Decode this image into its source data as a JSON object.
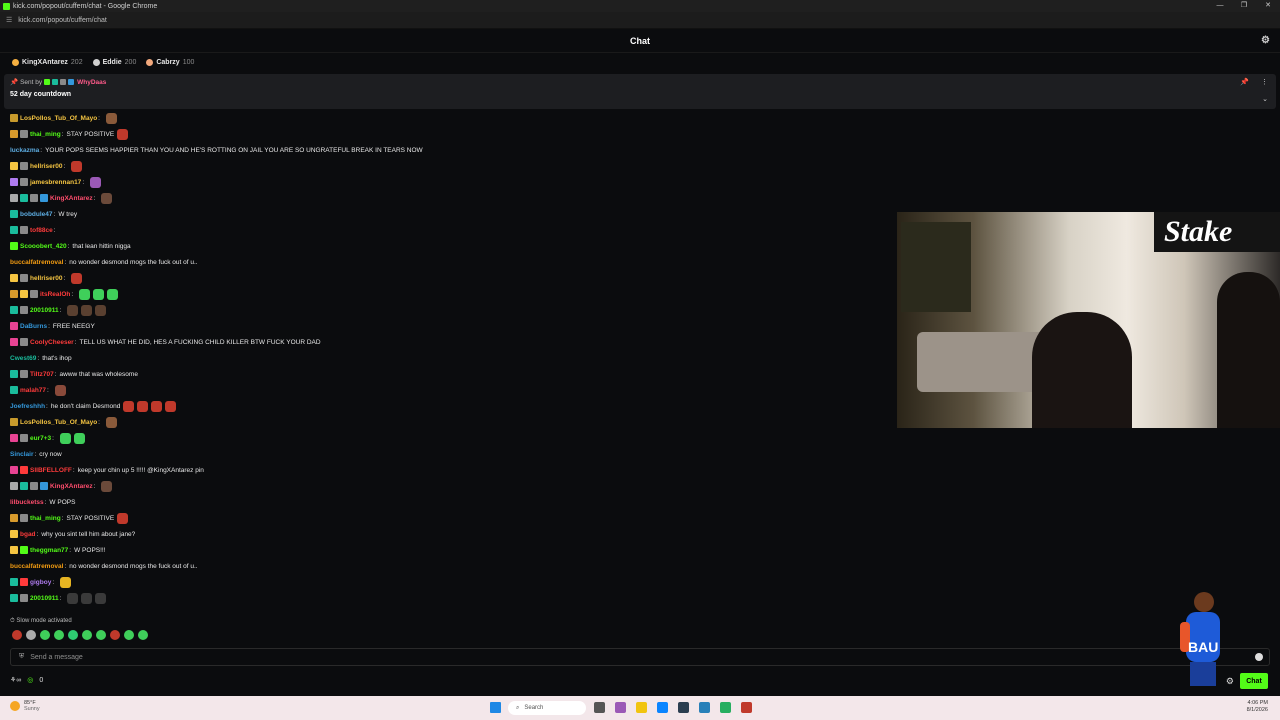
{
  "window": {
    "title": "kick.com/popout/cuffem/chat - Google Chrome",
    "url": "kick.com/popout/cuffem/chat"
  },
  "header": {
    "title": "Chat"
  },
  "leaderboard": [
    {
      "name": "KingXAntarez",
      "score": "202",
      "color": "#f5b041"
    },
    {
      "name": "Eddie",
      "score": "200",
      "color": "#d0d0d0"
    },
    {
      "name": "Cabrzy",
      "score": "100",
      "color": "#f2a97d"
    }
  ],
  "pinned": {
    "sent_by_label": "Sent by",
    "sender": "WhyDaas",
    "message": "52 day countdown"
  },
  "messages": [
    {
      "user": "LosPollos_Tub_Of_Mayo",
      "color": "#f5c542",
      "badges": [
        "#c79a2c"
      ],
      "text": "",
      "emotes": [
        "#8a5a3a"
      ]
    },
    {
      "user": "thai_ming",
      "color": "#53fc18",
      "badges": [
        "#d79a2c",
        "#8a8a8a"
      ],
      "text": "STAY POSITIVE",
      "emotes": [
        "#c0392b"
      ]
    },
    {
      "user": "luckazma",
      "color": "#5dade2",
      "badges": [],
      "text": "YOUR POPS SEEMS HAPPIER THAN YOU AND HE'S ROTTING ON JAIL  YOU ARE SO UNGRATEFUL  BREAK IN TEARS NOW",
      "emotes": []
    },
    {
      "user": "hellriser00",
      "color": "#f5c542",
      "badges": [
        "#f5c542",
        "#8a8a8a"
      ],
      "text": "",
      "emotes": [
        "#c0392b"
      ]
    },
    {
      "user": "jamesbrennan17",
      "color": "#f5c542",
      "badges": [
        "#b07cf0",
        "#8a8a8a"
      ],
      "text": "",
      "emotes": [
        "#9b59b6"
      ]
    },
    {
      "user": "KingXAntarez",
      "color": "#ff4d6d",
      "badges": [
        "#aaa",
        "#1abc9c",
        "#8a8a8a",
        "#3498db"
      ],
      "text": "",
      "emotes": [
        "#6b4a3a"
      ]
    },
    {
      "user": "bobdule47",
      "color": "#5dade2",
      "badges": [
        "#1abc9c"
      ],
      "text": "W trey",
      "emotes": []
    },
    {
      "user": "tof88ce",
      "color": "#ff3b3b",
      "badges": [
        "#1abc9c",
        "#8a8a8a"
      ],
      "text": "",
      "emotes": []
    },
    {
      "user": "Scooobert_420",
      "color": "#53fc18",
      "badges": [
        "#53fc18"
      ],
      "text": "that lean hittin nigga",
      "emotes": []
    },
    {
      "user": "buccalfatremoval",
      "color": "#f39c12",
      "badges": [],
      "text": "no wonder desmond mogs the fuck out of u..",
      "emotes": []
    },
    {
      "user": "hellriser00",
      "color": "#f5c542",
      "badges": [
        "#f5c542",
        "#8a8a8a"
      ],
      "text": "",
      "emotes": [
        "#c0392b"
      ]
    },
    {
      "user": "itsRealOh",
      "color": "#ff3b3b",
      "badges": [
        "#d79a2c",
        "#f5c542",
        "#8a8a8a"
      ],
      "text": "",
      "emotes": [
        "#3fcf5a",
        "#3fcf5a",
        "#3fcf5a"
      ]
    },
    {
      "user": "20010911",
      "color": "#53fc18",
      "badges": [
        "#1abc9c",
        "#8a8a8a"
      ],
      "text": "",
      "emotes": [
        "#5a4030",
        "#5a4030",
        "#5a4030"
      ]
    },
    {
      "user": "DaBurns",
      "color": "#3498db",
      "badges": [
        "#e84393"
      ],
      "text": "FREE NEEGY",
      "emotes": []
    },
    {
      "user": "CoolyCheeser",
      "color": "#ff3b3b",
      "badges": [
        "#e84393",
        "#8a8a8a"
      ],
      "text": "TELL US WHAT HE DID, HES A FUCKING CHILD KILLER BTW FUCK YOUR DAD",
      "emotes": []
    },
    {
      "user": "Cwest69",
      "color": "#1abc9c",
      "badges": [],
      "text": "that's ihop",
      "emotes": []
    },
    {
      "user": "Tiltz707",
      "color": "#ff3b3b",
      "badges": [
        "#1abc9c",
        "#8a8a8a"
      ],
      "text": "awww that was wholesome",
      "emotes": []
    },
    {
      "user": "malah77",
      "color": "#ff3b3b",
      "badges": [
        "#1abc9c"
      ],
      "text": "",
      "emotes": [
        "#8a4a3a"
      ]
    },
    {
      "user": "Joefreshhh",
      "color": "#3498db",
      "badges": [],
      "text": "he don't claim Desmond",
      "emotes": [
        "#c0392b",
        "#c0392b",
        "#c0392b",
        "#c0392b"
      ]
    },
    {
      "user": "LosPollos_Tub_Of_Mayo",
      "color": "#f5c542",
      "badges": [
        "#c79a2c"
      ],
      "text": "",
      "emotes": [
        "#8a5a3a"
      ]
    },
    {
      "user": "eur7+3",
      "color": "#53fc18",
      "badges": [
        "#e84393",
        "#8a8a8a"
      ],
      "text": "",
      "emotes": [
        "#3fcf5a",
        "#3fcf5a"
      ]
    },
    {
      "user": "Sinclair",
      "color": "#3498db",
      "badges": [],
      "text": "cry now",
      "emotes": []
    },
    {
      "user": "SIIBFELLOFF",
      "color": "#ff3b3b",
      "badges": [
        "#e84393",
        "#ff3b3b"
      ],
      "text": "keep your chin up 5 !!!!! @KingXAntarez pin",
      "emotes": []
    },
    {
      "user": "KingXAntarez",
      "color": "#ff4d6d",
      "badges": [
        "#aaa",
        "#1abc9c",
        "#8a8a8a",
        "#3498db"
      ],
      "text": "",
      "emotes": [
        "#6b4a3a"
      ]
    },
    {
      "user": "lilbucketss",
      "color": "#ff4d6d",
      "badges": [],
      "text": "W POPS",
      "emotes": []
    },
    {
      "user": "thai_ming",
      "color": "#53fc18",
      "badges": [
        "#d79a2c",
        "#8a8a8a"
      ],
      "text": "STAY POSITIVE",
      "emotes": [
        "#c0392b"
      ]
    },
    {
      "user": "bgad",
      "color": "#ff3b3b",
      "badges": [
        "#f5c542"
      ],
      "text": "why you sint tell him about jane?",
      "emotes": []
    },
    {
      "user": "theggman77",
      "color": "#53fc18",
      "badges": [
        "#f5c542",
        "#53fc18"
      ],
      "text": "W POPS!!!",
      "emotes": []
    },
    {
      "user": "buccalfatremoval",
      "color": "#f39c12",
      "badges": [],
      "text": "no wonder desmond mogs the fuck out of u..",
      "emotes": []
    },
    {
      "user": "gigboy",
      "color": "#b07cf0",
      "badges": [
        "#1abc9c",
        "#ff3b3b"
      ],
      "text": "",
      "emotes": [
        "#e6b422"
      ]
    },
    {
      "user": "20010911",
      "color": "#53fc18",
      "badges": [
        "#1abc9c",
        "#8a8a8a"
      ],
      "text": "",
      "emotes": [
        "#3a3a3a",
        "#3a3a3a",
        "#3a3a3a"
      ]
    }
  ],
  "slow_mode": "Slow mode activated",
  "input": {
    "placeholder": "Send a message"
  },
  "bottom": {
    "count": "0",
    "chat_button": "Chat"
  },
  "taskbar": {
    "temp": "85°F",
    "condition": "Sunny",
    "search": "Search",
    "time": "4:06 PM",
    "date": "8/1/2026"
  },
  "video": {
    "brand": "Stake"
  }
}
